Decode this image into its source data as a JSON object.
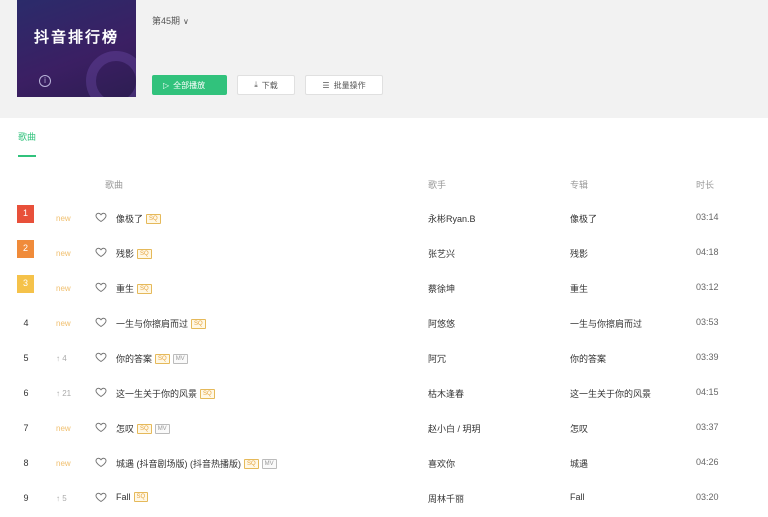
{
  "playlist": {
    "cover_title": "抖音排行榜",
    "creator": "第45期"
  },
  "actions": {
    "play_all": "全部播放",
    "download": "下载",
    "batch": "批量操作"
  },
  "tabs": [
    {
      "label": "歌曲"
    }
  ],
  "table": {
    "headers": {
      "song": "歌曲",
      "artist": "歌手",
      "album": "专辑",
      "duration": "时长"
    },
    "rows": [
      {
        "rank": "1",
        "trend": "new",
        "title": "像极了",
        "tags": [
          "SQ"
        ],
        "artist": "永彬Ryan.B",
        "album": "像极了",
        "duration": "03:14"
      },
      {
        "rank": "2",
        "trend": "new",
        "title": "残影",
        "tags": [
          "SQ"
        ],
        "artist": "张艺兴",
        "album": "残影",
        "duration": "04:18"
      },
      {
        "rank": "3",
        "trend": "new",
        "title": "重生",
        "tags": [
          "SQ"
        ],
        "artist": "蔡徐坤",
        "album": "重生",
        "duration": "03:12"
      },
      {
        "rank": "4",
        "trend": "new",
        "title": "一生与你擦肩而过",
        "tags": [
          "SQ"
        ],
        "artist": "阿悠悠",
        "album": "一生与你擦肩而过",
        "duration": "03:53"
      },
      {
        "rank": "5",
        "trend": "↑ 4",
        "title": "你的答案",
        "tags": [
          "SQ",
          "MV"
        ],
        "artist": "阿冗",
        "album": "你的答案",
        "duration": "03:39"
      },
      {
        "rank": "6",
        "trend": "↑ 21",
        "title": "这一生关于你的风景",
        "tags": [
          "SQ"
        ],
        "artist": "枯木逢春",
        "album": "这一生关于你的风景",
        "duration": "04:15"
      },
      {
        "rank": "7",
        "trend": "new",
        "title": "怎叹",
        "tags": [
          "SQ",
          "MV"
        ],
        "artist": "赵小白 / 玥玥",
        "album": "怎叹",
        "duration": "03:37"
      },
      {
        "rank": "8",
        "trend": "new",
        "title": "城遇 (抖音剧场版) (抖音热播版)",
        "tags": [
          "SQ",
          "MV"
        ],
        "artist": "喜欢你",
        "album": "城遇",
        "duration": "04:26"
      },
      {
        "rank": "9",
        "trend": "↑ 5",
        "title": "Fall",
        "tags": [
          "SQ"
        ],
        "artist": "周林千丽",
        "album": "Fall",
        "duration": "03:20"
      }
    ]
  }
}
